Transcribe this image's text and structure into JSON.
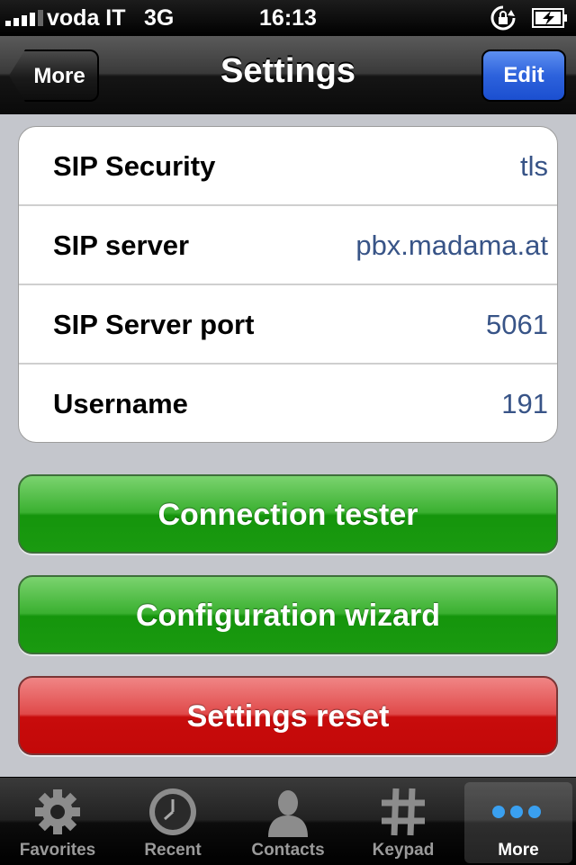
{
  "status_bar": {
    "carrier": "voda IT",
    "network": "3G",
    "time": "16:13"
  },
  "nav": {
    "back_label": "More",
    "title": "Settings",
    "edit_label": "Edit"
  },
  "settings": [
    {
      "label": "SIP Security",
      "value": "tls"
    },
    {
      "label": "SIP server",
      "value": "pbx.madama.at"
    },
    {
      "label": "SIP Server port",
      "value": "5061"
    },
    {
      "label": "Username",
      "value": "191"
    }
  ],
  "buttons": {
    "connection_tester": "Connection tester",
    "configuration_wizard": "Configuration wizard",
    "settings_reset": "Settings reset"
  },
  "tabs": [
    {
      "label": "Favorites",
      "icon": "gear-icon"
    },
    {
      "label": "Recent",
      "icon": "clock-icon"
    },
    {
      "label": "Contacts",
      "icon": "person-icon"
    },
    {
      "label": "Keypad",
      "icon": "hash-icon"
    },
    {
      "label": "More",
      "icon": "more-dots-icon",
      "active": true
    }
  ],
  "colors": {
    "value_text": "#385487",
    "edit_blue": "#2d62dc",
    "green_button": "#1a9a10",
    "red_button": "#c80c0c",
    "more_dots": "#3aa0f0"
  }
}
